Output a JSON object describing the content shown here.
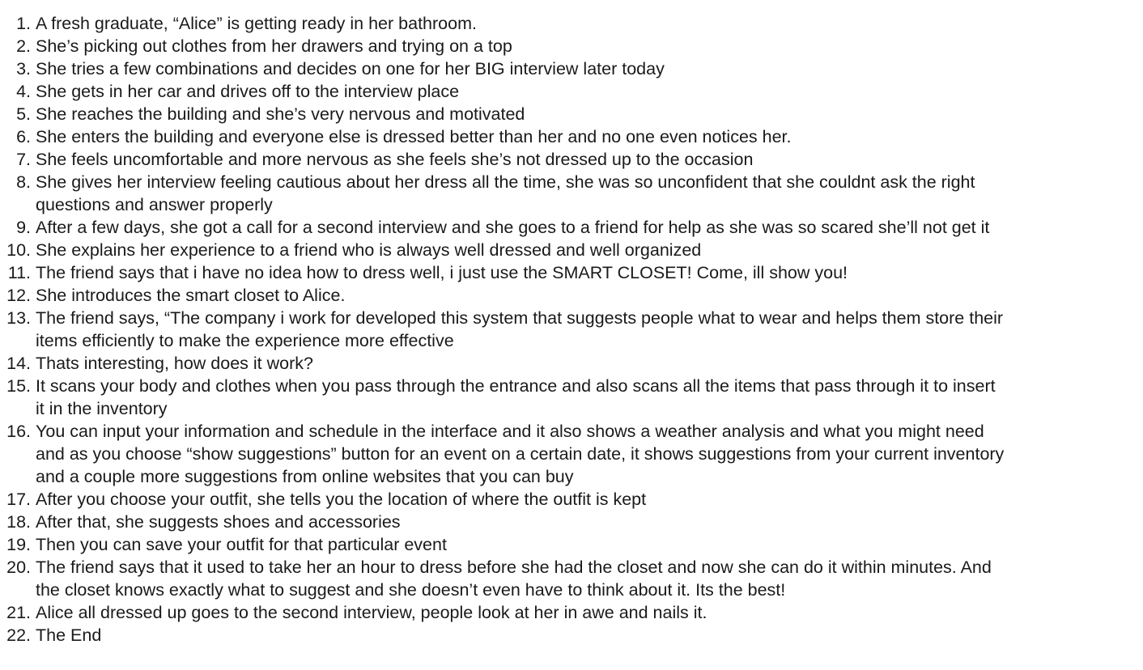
{
  "story": {
    "items": [
      {
        "num": "1.",
        "lines": [
          "A fresh graduate, “Alice” is getting ready in her bathroom."
        ]
      },
      {
        "num": "2.",
        "lines": [
          "She’s picking out clothes from her drawers and trying on a top"
        ]
      },
      {
        "num": "3.",
        "lines": [
          "She tries a few combinations and decides on one for her BIG interview later today"
        ]
      },
      {
        "num": "4.",
        "lines": [
          "She gets in her car and drives off to the interview place"
        ]
      },
      {
        "num": "5.",
        "lines": [
          "She reaches the building and she’s very nervous and motivated"
        ]
      },
      {
        "num": "6.",
        "lines": [
          "She enters the building and everyone else is dressed better than her and no one even notices her."
        ]
      },
      {
        "num": "7.",
        "lines": [
          "She feels uncomfortable and more nervous as she feels she’s not dressed up to the occasion"
        ]
      },
      {
        "num": "8.",
        "lines": [
          "She gives her interview feeling cautious about her dress all the time, she was so unconfident that she couldnt ask the right",
          "questions and answer properly"
        ]
      },
      {
        "num": "9.",
        "lines": [
          "After a few days, she got a call for a second interview and she goes to a friend for help as she was so scared she’ll not get it"
        ]
      },
      {
        "num": "10.",
        "lines": [
          "She explains her experience to a friend who is always well dressed and well organized"
        ]
      },
      {
        "num": "11.",
        "lines": [
          "The friend says that i have no idea how to dress well, i just use the SMART CLOSET! Come, ill show you!"
        ]
      },
      {
        "num": "12.",
        "lines": [
          "She introduces the smart closet to Alice."
        ]
      },
      {
        "num": "13.",
        "lines": [
          "The friend says, “The company i work for developed this system that suggests people what to wear and helps them store their",
          "items efficiently to make the experience more effective"
        ]
      },
      {
        "num": "14.",
        "lines": [
          "Thats interesting, how does it work?"
        ]
      },
      {
        "num": "15.",
        "lines": [
          "It scans your body and clothes when you pass through the entrance and also scans all the items that pass through it to insert",
          "it in the inventory"
        ]
      },
      {
        "num": "16.",
        "lines": [
          "You can input your information and schedule in the interface and it also shows a weather analysis and what you might need",
          "and as you choose “show suggestions” button for an event on a certain date, it shows suggestions from your current inventory",
          "and a couple more suggestions from online websites that you can buy"
        ]
      },
      {
        "num": "17.",
        "lines": [
          "After you choose your outfit, she tells you the location of where the outfit is kept"
        ]
      },
      {
        "num": "18.",
        "lines": [
          "After that, she suggests shoes and accessories"
        ]
      },
      {
        "num": "19.",
        "lines": [
          "Then you can save your outfit for that particular event"
        ]
      },
      {
        "num": "20.",
        "lines": [
          "The friend says that it used to take her an hour to dress before she had the closet and now she can do it within minutes. And",
          "the closet knows exactly what to suggest and she doesn’t even have to think about it. Its the best!"
        ]
      },
      {
        "num": "21.",
        "lines": [
          "Alice all dressed up goes to the second interview, people look at her in awe and nails it."
        ]
      },
      {
        "num": "22.",
        "lines": [
          "The End"
        ]
      }
    ]
  }
}
